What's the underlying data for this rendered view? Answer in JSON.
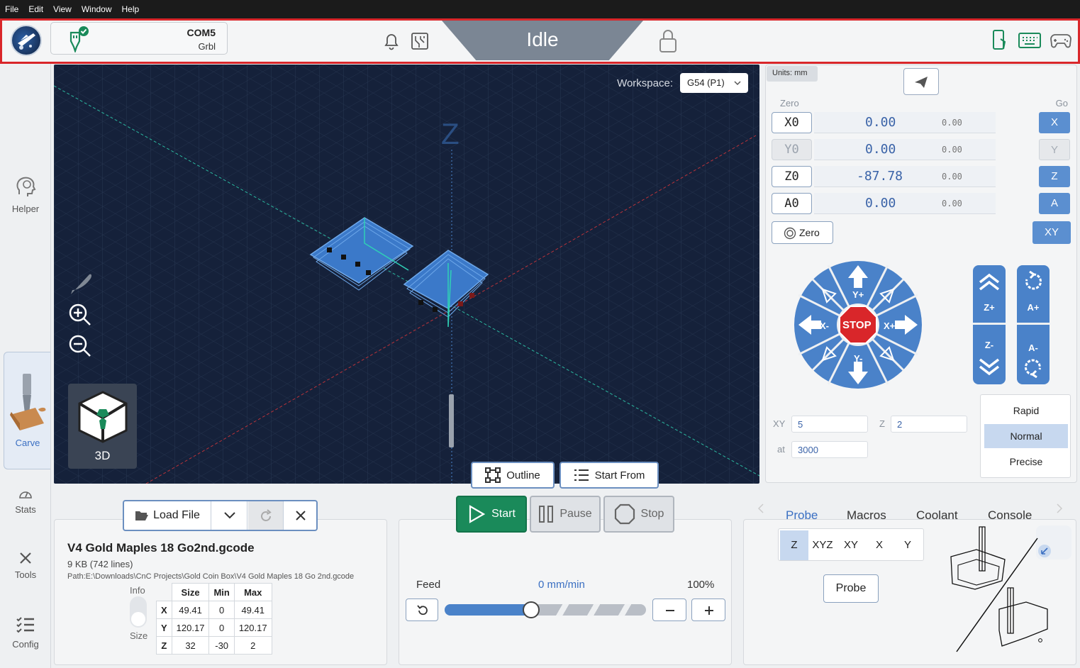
{
  "menu": [
    "File",
    "Edit",
    "View",
    "Window",
    "Help"
  ],
  "header": {
    "port": "COM5",
    "firmware": "Grbl",
    "state": "Idle"
  },
  "sidebar": {
    "helper": "Helper",
    "carve": "Carve",
    "stats": "Stats",
    "tools": "Tools",
    "config": "Config"
  },
  "visualizer": {
    "workspace_label": "Workspace:",
    "workspace_value": "G54 (P1)",
    "axis_label": "Z",
    "view_mode": "3D"
  },
  "dro": {
    "units": "Units: mm",
    "zero_header": "Zero",
    "go_header": "Go",
    "axes": [
      {
        "zero": "X0",
        "value": "0.00",
        "machine": "0.00",
        "go": "X",
        "enabled": true
      },
      {
        "zero": "Y0",
        "value": "0.00",
        "machine": "0.00",
        "go": "Y",
        "enabled": false
      },
      {
        "zero": "Z0",
        "value": "-87.78",
        "machine": "0.00",
        "go": "Z",
        "enabled": true
      },
      {
        "zero": "A0",
        "value": "0.00",
        "machine": "0.00",
        "go": "A",
        "enabled": true
      }
    ],
    "zero_all": "Zero",
    "go_xy": "XY"
  },
  "jog": {
    "labels": {
      "y_plus": "Y+",
      "y_minus": "Y-",
      "x_plus": "X+",
      "x_minus": "X-",
      "stop": "STOP",
      "z_plus": "Z+",
      "z_minus": "Z-",
      "a_plus": "A+",
      "a_minus": "A-"
    },
    "xy_label": "XY",
    "xy_value": "5",
    "z_label": "Z",
    "z_value": "2",
    "at_label": "at",
    "feed_value": "3000",
    "speeds": [
      "Rapid",
      "Normal",
      "Precise"
    ],
    "selected_speed": "Normal"
  },
  "file": {
    "load_label": "Load File",
    "name": "V4 Gold Maples 18 Go2nd.gcode",
    "size": "9 KB (742 lines)",
    "path": "Path:E:\\Downloads\\CnC Projects\\Gold Coin Box\\V4 Gold Maples 18 Go 2nd.gcode",
    "toggle_top": "Info",
    "toggle_bottom": "Size",
    "table_headers": [
      "Size",
      "Min",
      "Max"
    ],
    "table_rows": [
      {
        "axis": "X",
        "size": "49.41",
        "min": "0",
        "max": "49.41"
      },
      {
        "axis": "Y",
        "size": "120.17",
        "min": "0",
        "max": "120.17"
      },
      {
        "axis": "Z",
        "size": "32",
        "min": "-30",
        "max": "2"
      }
    ]
  },
  "job": {
    "outline": "Outline",
    "start_from": "Start From",
    "start": "Start",
    "pause": "Pause",
    "stop": "Stop",
    "feed_label": "Feed",
    "feed_value": "0 mm/min",
    "feed_percent": "100%",
    "feed_slider_fraction": 0.43
  },
  "tools": {
    "tabs": [
      "Probe",
      "Macros",
      "Coolant",
      "Console"
    ],
    "active_tab": "Probe",
    "probe_axes": [
      "Z",
      "XYZ",
      "XY",
      "X",
      "Y"
    ],
    "probe_selected": "Z",
    "probe_button": "Probe"
  },
  "colors": {
    "accent": "#3a6fc2",
    "jog_blue": "#4a82c9",
    "start_green": "#1a8a5a",
    "stop_red": "#d9262a",
    "viz_bg": "#15213a",
    "header_border": "#d9262a"
  }
}
